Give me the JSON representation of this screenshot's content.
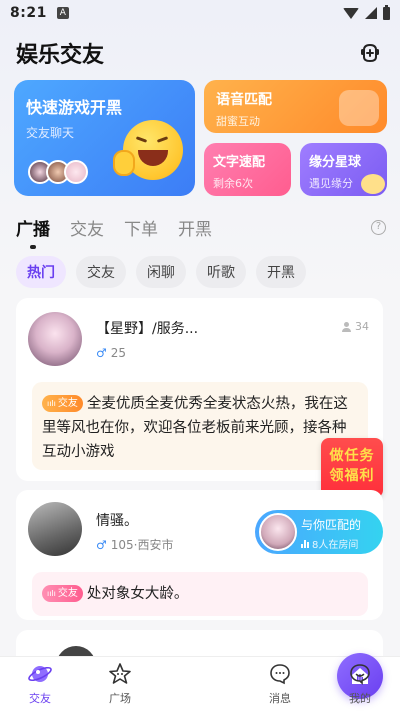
{
  "status_bar": {
    "time": "8:21",
    "notification": "A"
  },
  "header": {
    "title": "娱乐交友"
  },
  "banners": {
    "main": {
      "title": "快速游戏开黑",
      "subtitle": "交友聊天"
    },
    "voice": {
      "title": "语音匹配",
      "subtitle": "甜蜜互动"
    },
    "text": {
      "title": "文字速配",
      "subtitle": "剩余6次"
    },
    "star": {
      "title": "缘分星球",
      "subtitle": "遇见缘分"
    }
  },
  "tabs": [
    {
      "label": "广播",
      "active": true
    },
    {
      "label": "交友",
      "active": false
    },
    {
      "label": "下单",
      "active": false
    },
    {
      "label": "开黑",
      "active": false
    }
  ],
  "help": "?",
  "chips": [
    {
      "label": "热门",
      "active": true
    },
    {
      "label": "交友",
      "active": false
    },
    {
      "label": "闲聊",
      "active": false
    },
    {
      "label": "听歌",
      "active": false
    },
    {
      "label": "开黑",
      "active": false
    }
  ],
  "posts": [
    {
      "name": "【星野】/服务...",
      "gender": "♂",
      "meta": "25",
      "viewers": "34",
      "tag": "交友",
      "message": "全麦优质全麦优秀全麦状态火热，我在这里等风也在你，欢迎各位老板前来光顾，接各种互动小游戏"
    },
    {
      "name": "情骚。",
      "gender": "♂",
      "meta": "105·西安市",
      "tag": "交友",
      "message": "处对象女大龄。"
    }
  ],
  "task_badge": {
    "line1": "做任务",
    "line2": "领福利"
  },
  "match": {
    "line1": "与你匹配的",
    "line2": "8人在房间"
  },
  "nav": [
    {
      "label": "交友",
      "icon": "planet-icon",
      "active": true
    },
    {
      "label": "广场",
      "icon": "star-face-icon",
      "active": false
    },
    {
      "label": "",
      "icon": "home-voice-icon",
      "active": false
    },
    {
      "label": "消息",
      "icon": "chat-bubble-icon",
      "active": false
    },
    {
      "label": "我的",
      "icon": "profile-bubble-icon",
      "active": false
    }
  ],
  "colors": {
    "accent": "#6a3ff0",
    "male": "#3b8bf5",
    "task_red": "#ff2e3a"
  }
}
